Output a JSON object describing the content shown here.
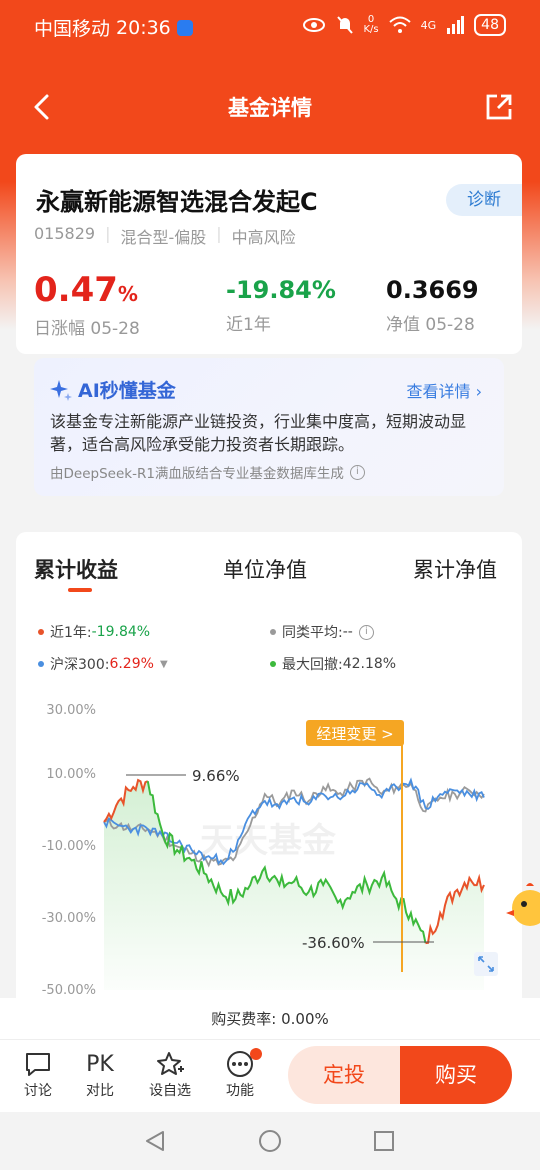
{
  "status": {
    "carrier": "中国移动",
    "time": "20:36",
    "net_speed": "0\nK/s",
    "signal": "4G",
    "battery": "48"
  },
  "nav": {
    "title": "基金详情"
  },
  "fund": {
    "name": "永赢新能源智选混合发起C",
    "code": "015829",
    "type": "混合型-偏股",
    "risk": "中高风险",
    "diagnose": "诊断",
    "daily_change": "0.47",
    "daily_change_unit": "%",
    "daily_label": "日涨幅 05-28",
    "year_change": "-19.84%",
    "year_label": "近1年",
    "nav_value": "0.3669",
    "nav_label": "净值 05-28"
  },
  "ai": {
    "title": "AI秒懂基金",
    "more": "查看详情",
    "body": "该基金专注新能源产业链投资，行业集中度高，短期波动显著，适合高风险承受能力投资者长期跟踪。",
    "source": "由DeepSeek-R1满血版结合专业基金数据库生成"
  },
  "chart_tabs": [
    "累计收益",
    "单位净值",
    "累计净值"
  ],
  "legend": {
    "fund_label": "近1年:",
    "fund_value": "-19.84%",
    "peer_label": "同类平均:",
    "peer_value": "--",
    "index_label": "沪深300:",
    "index_value": "6.29%",
    "drawdown_label": "最大回撤:",
    "drawdown_value": "42.18%"
  },
  "annotations": {
    "manager_change": "经理变更 >",
    "peak": "9.66%",
    "trough": "-36.60%",
    "watermark": "天天基金"
  },
  "colors": {
    "fund": "#e8532a",
    "fund_drawdown": "#3cb93c",
    "peer": "#9a9a9a",
    "index": "#4a8fe0",
    "accent": "#f2481b"
  },
  "chart_data": {
    "type": "line",
    "yticks": [
      "30.00%",
      "10.00%",
      "-10.00%",
      "-30.00%",
      "-50.00%"
    ],
    "ylim": [
      -50,
      30
    ],
    "series": [
      {
        "name": "近1年",
        "values": [
          -2,
          4,
          8,
          9.66,
          -5,
          -10,
          -13,
          -17,
          -22,
          -24,
          -20,
          -15,
          -20,
          -19,
          -22,
          -20,
          -25,
          -22,
          -20,
          -18,
          -24,
          -28,
          -36.6,
          -28,
          -22,
          -18,
          -20
        ]
      },
      {
        "name": "同类平均",
        "values": [
          -2,
          -3,
          -4,
          -4,
          -6,
          -9,
          -11,
          -13,
          -14,
          -12,
          -3,
          6,
          3,
          7,
          4,
          8,
          6,
          8,
          10,
          6,
          8,
          9,
          1,
          5,
          6,
          7,
          6
        ]
      },
      {
        "name": "沪深300",
        "values": [
          -2,
          -3,
          -4,
          -4,
          -6,
          -8,
          -10,
          -12,
          -13,
          -10,
          0,
          4,
          2,
          5,
          3,
          6,
          5,
          7,
          9,
          5,
          8,
          10,
          2,
          6,
          7,
          6,
          5
        ]
      }
    ],
    "grid": false,
    "legend_position": "top"
  },
  "fee": {
    "label": "购买费率:",
    "value": "0.00%"
  },
  "bottom": {
    "discuss": "讨论",
    "compare_icon": "PK",
    "compare": "对比",
    "watch": "设自选",
    "func": "功能",
    "dingtou": "定投",
    "buy": "购买"
  }
}
